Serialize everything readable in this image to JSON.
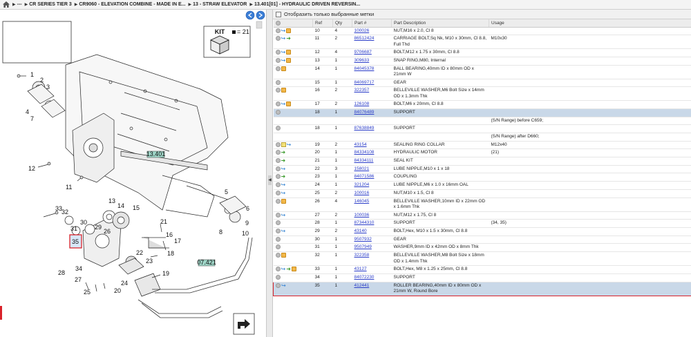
{
  "breadcrumb": [
    "---",
    "CR SERIES TIER 3",
    "CR9060 - ELEVATION COMBINE - MADE IN E...",
    "13 - STRAW ELEVATOR",
    "13.401[01] - HYDRAULIC DRIVEN REVERSIN..."
  ],
  "filter_label": "Отобразить только выбранные метки",
  "columns": [
    "Ref",
    "Qty",
    "Part #",
    "Part Description",
    "Usage"
  ],
  "diagram": {
    "kit_label": "KIT",
    "kit_count": "= 21",
    "tag_1": "13.401",
    "tag_2": "07.421",
    "callouts": [
      "1",
      "2",
      "3",
      "4",
      "5",
      "6",
      "7",
      "8",
      "9",
      "10",
      "11",
      "12",
      "13",
      "14",
      "15",
      "16",
      "17",
      "18",
      "19",
      "20",
      "21",
      "22",
      "23",
      "24",
      "25",
      "26",
      "27",
      "28",
      "29",
      "30",
      "31",
      "32",
      "33",
      "34",
      "35"
    ]
  },
  "rows": [
    {
      "icons": [
        "circle",
        "arrow",
        "box"
      ],
      "ref": "10",
      "qty": "4",
      "part": "100026",
      "desc": "NUT,M16 x 2.0, Cl 8",
      "usage": "",
      "state": ""
    },
    {
      "icons": [
        "circle",
        "arrow",
        "green"
      ],
      "ref": "11",
      "qty": "2",
      "part": "86512424",
      "desc": "CARRIAGE BOLT,Sq Nk, M10 x 30mm, Cl 8.8, Full Thd",
      "usage": "M10x30",
      "state": ""
    },
    {
      "icons": [
        "circle",
        "arrow",
        "box"
      ],
      "ref": "12",
      "qty": "4",
      "part": "9706687",
      "desc": "BOLT,M12 x 1.75 x 30mm, Cl 8.8",
      "usage": "",
      "state": ""
    },
    {
      "icons": [
        "circle",
        "arrow",
        "box"
      ],
      "ref": "13",
      "qty": "1",
      "part": "309633",
      "desc": "SNAP RING,M80, Internal",
      "usage": "",
      "state": ""
    },
    {
      "icons": [
        "circle",
        "box"
      ],
      "ref": "14",
      "qty": "1",
      "part": "84045378",
      "desc": "BALL BEARING,40mm ID x 80mm OD x 21mm W",
      "usage": "",
      "state": ""
    },
    {
      "icons": [
        "circle"
      ],
      "ref": "15",
      "qty": "1",
      "part": "84069717",
      "desc": "GEAR",
      "usage": "",
      "state": ""
    },
    {
      "icons": [
        "circle",
        "box"
      ],
      "ref": "16",
      "qty": "2",
      "part": "322357",
      "desc": "BELLEVILLE WASHER,M6 Bolt Size x 14mm OD x 1.3mm Thk",
      "usage": "",
      "state": ""
    },
    {
      "icons": [
        "circle",
        "arrow",
        "box"
      ],
      "ref": "17",
      "qty": "2",
      "part": "126108",
      "desc": "BOLT,M6 x 20mm, Cl 8.8",
      "usage": "",
      "state": ""
    },
    {
      "icons": [
        "circle"
      ],
      "ref": "18",
      "qty": "1",
      "part": "84076489",
      "desc": "SUPPORT",
      "usage": "",
      "state": "sel"
    },
    {
      "icons": [],
      "ref": "",
      "qty": "",
      "part": "",
      "desc": "",
      "usage": "(S/N Range) before C659;",
      "state": ""
    },
    {
      "icons": [
        "circle"
      ],
      "ref": "18",
      "qty": "1",
      "part": "87638849",
      "desc": "SUPPORT",
      "usage": "",
      "state": ""
    },
    {
      "icons": [],
      "ref": "",
      "qty": "",
      "part": "",
      "desc": "",
      "usage": "(S/N Range) after D660;",
      "state": ""
    },
    {
      "icons": [
        "circle",
        "doc",
        "arrow"
      ],
      "ref": "19",
      "qty": "2",
      "part": "43154",
      "desc": "SEALING RING COLLAR",
      "usage": "M12x40",
      "state": ""
    },
    {
      "icons": [
        "circle",
        "green"
      ],
      "ref": "20",
      "qty": "1",
      "part": "84334108",
      "desc": "HYDRAULIC MOTOR",
      "usage": "(21)",
      "state": ""
    },
    {
      "icons": [
        "circle",
        "green"
      ],
      "ref": "21",
      "qty": "1",
      "part": "84334111",
      "desc": "SEAL KIT",
      "usage": "",
      "state": ""
    },
    {
      "icons": [
        "circle",
        "arrow"
      ],
      "ref": "22",
      "qty": "3",
      "part": "158021",
      "desc": "LUBE NIPPLE,M10 x 1 x 18",
      "usage": "",
      "state": ""
    },
    {
      "icons": [
        "circle",
        "green"
      ],
      "ref": "23",
      "qty": "1",
      "part": "84071586",
      "desc": "COUPLING",
      "usage": "",
      "state": ""
    },
    {
      "icons": [
        "circle",
        "arrow"
      ],
      "ref": "24",
      "qty": "1",
      "part": "321204",
      "desc": "LUBE NIPPLE,M6 x 1.0 x 16mm OAL",
      "usage": "",
      "state": ""
    },
    {
      "icons": [
        "circle",
        "arrow"
      ],
      "ref": "25",
      "qty": "2",
      "part": "100016",
      "desc": "NUT,M10 x 1.5, Cl 8",
      "usage": "",
      "state": ""
    },
    {
      "icons": [
        "circle",
        "box"
      ],
      "ref": "26",
      "qty": "4",
      "part": "146045",
      "desc": "BELLEVILLE WASHER,10mm ID x 22mm OD x 1.6mm Thk",
      "usage": "",
      "state": ""
    },
    {
      "icons": [
        "circle",
        "arrow"
      ],
      "ref": "27",
      "qty": "2",
      "part": "100036",
      "desc": "NUT,M12 x 1.75, Cl 8",
      "usage": "",
      "state": ""
    },
    {
      "icons": [
        "circle"
      ],
      "ref": "28",
      "qty": "1",
      "part": "87344310",
      "desc": "SUPPORT",
      "usage": "(34, 35)",
      "state": ""
    },
    {
      "icons": [
        "circle",
        "arrow"
      ],
      "ref": "29",
      "qty": "2",
      "part": "43140",
      "desc": "BOLT,Hex, M10 x 1.5 x 30mm, Cl 8.8",
      "usage": "",
      "state": ""
    },
    {
      "icons": [
        "circle"
      ],
      "ref": "30",
      "qty": "1",
      "part": "9507932",
      "desc": "GEAR",
      "usage": "",
      "state": ""
    },
    {
      "icons": [
        "circle"
      ],
      "ref": "31",
      "qty": "1",
      "part": "9507949",
      "desc": "WASHER,9mm ID x 42mm OD x 8mm Thk",
      "usage": "",
      "state": ""
    },
    {
      "icons": [
        "circle",
        "box"
      ],
      "ref": "32",
      "qty": "1",
      "part": "322358",
      "desc": "BELLEVILLE WASHER,M8 Bolt Size x 18mm OD x 1.4mm Thk",
      "usage": "",
      "state": ""
    },
    {
      "icons": [
        "circle",
        "arrow",
        "green",
        "box"
      ],
      "ref": "33",
      "qty": "1",
      "part": "43127",
      "desc": "BOLT,Hex, M8 x 1.25 x 25mm, Cl 8.8",
      "usage": "",
      "state": ""
    },
    {
      "icons": [
        "circle"
      ],
      "ref": "34",
      "qty": "1",
      "part": "84072230",
      "desc": "SUPPORT",
      "usage": "",
      "state": ""
    },
    {
      "icons": [
        "circle",
        "arrow"
      ],
      "ref": "35",
      "qty": "1",
      "part": "412441",
      "desc": "ROLLER BEARING,40mm ID x 80mm OD x 21mm W, Round Bore",
      "usage": "",
      "state": "sel hl"
    }
  ],
  "colors": {
    "link": "#2a3cc8",
    "selected_row": "#c9d8e8",
    "highlight": "#d9222a",
    "tag": "#9fd6c8"
  }
}
